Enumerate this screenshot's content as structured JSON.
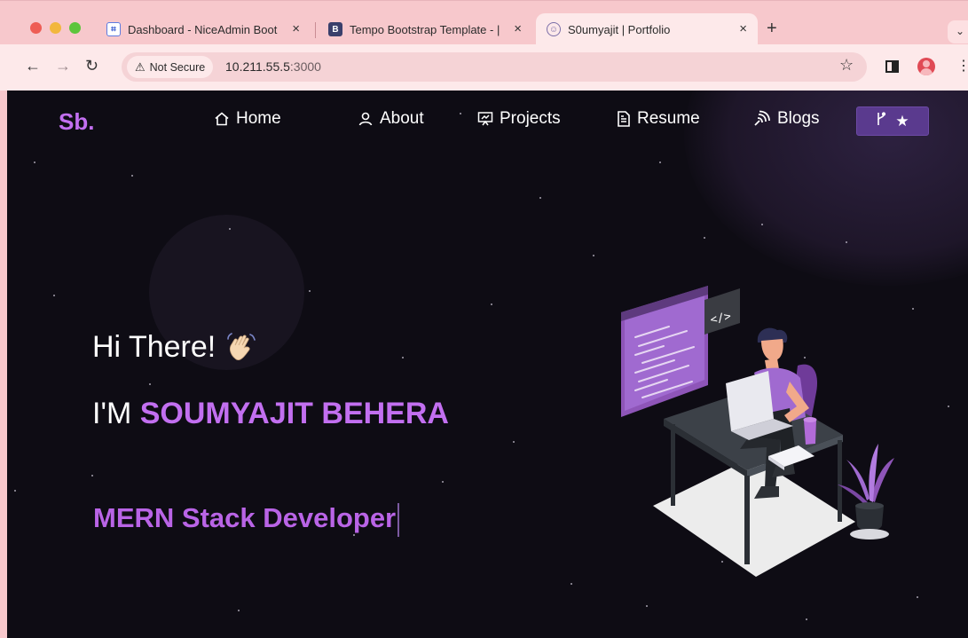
{
  "browser": {
    "tabs": [
      {
        "title": "Dashboard - NiceAdmin Boot",
        "favicon": "niceadmin-logo-icon"
      },
      {
        "title": "Tempo Bootstrap Template - |",
        "favicon_letter": "B"
      },
      {
        "title": "S0umyajit | Portfolio",
        "favicon": "portfolio-logo-icon"
      }
    ],
    "tab_close": "×",
    "new_tab": "+",
    "tab_menu": "⌄",
    "security_label": "Not Secure",
    "url_host": "10.211.55.5",
    "url_port": ":3000"
  },
  "nav": {
    "logo": "Sb.",
    "links": [
      "Home",
      "About",
      "Projects",
      "Resume",
      "Blogs"
    ]
  },
  "hero": {
    "greeting": "Hi There!",
    "intro_prefix": "I'M ",
    "name": "SOUMYAJIT BEHERA",
    "role": "MERN Stack Developer"
  },
  "colors": {
    "accent": "#c26ff0",
    "background": "#0e0c14",
    "button": "#5a3a8e",
    "chrome": "#f7c8cc"
  }
}
